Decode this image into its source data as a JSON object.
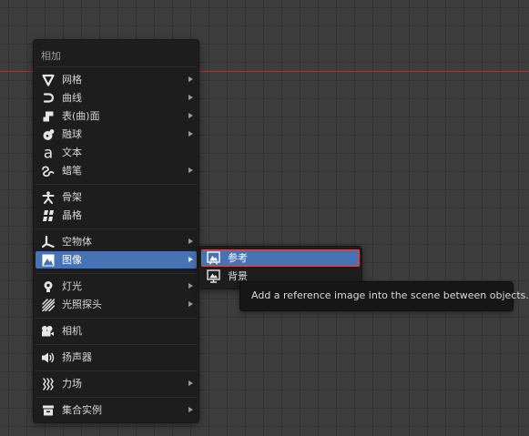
{
  "menu": {
    "title": "相加",
    "items": [
      {
        "label": "网格",
        "icon": "mesh-icon",
        "submenu": true
      },
      {
        "label": "曲线",
        "icon": "curve-icon",
        "submenu": true
      },
      {
        "label": "表(曲)面",
        "icon": "surface-icon",
        "submenu": true
      },
      {
        "label": "融球",
        "icon": "metaball-icon",
        "submenu": true
      },
      {
        "label": "文本",
        "icon": "text-icon",
        "submenu": false
      },
      {
        "label": "蜡笔",
        "icon": "grease-pencil-icon",
        "submenu": true
      },
      {
        "label": "骨架",
        "icon": "armature-icon",
        "submenu": false
      },
      {
        "label": "晶格",
        "icon": "lattice-icon",
        "submenu": false
      },
      {
        "label": "空物体",
        "icon": "empty-icon",
        "submenu": true
      },
      {
        "label": "图像",
        "icon": "image-icon",
        "submenu": true,
        "active": true
      },
      {
        "label": "灯光",
        "icon": "light-icon",
        "submenu": true
      },
      {
        "label": "光照探头",
        "icon": "light-probe-icon",
        "submenu": true
      },
      {
        "label": "相机",
        "icon": "camera-icon",
        "submenu": false
      },
      {
        "label": "扬声器",
        "icon": "speaker-icon",
        "submenu": false
      },
      {
        "label": "力场",
        "icon": "force-field-icon",
        "submenu": true
      },
      {
        "label": "集合实例",
        "icon": "collection-instance-icon",
        "submenu": true
      }
    ]
  },
  "submenu": {
    "items": [
      {
        "label": "参考",
        "icon": "image-reference-icon",
        "active": true
      },
      {
        "label": "背景",
        "icon": "image-background-icon"
      }
    ]
  },
  "tooltip": {
    "text": "Add a reference image into the scene between objects."
  },
  "colors": {
    "highlight": "#4772b3",
    "menu_bg": "#1d1d1d",
    "viewport_bg": "#3d3d3d",
    "x_axis": "#8d3b44",
    "focus_outline": "#d54a4a"
  }
}
